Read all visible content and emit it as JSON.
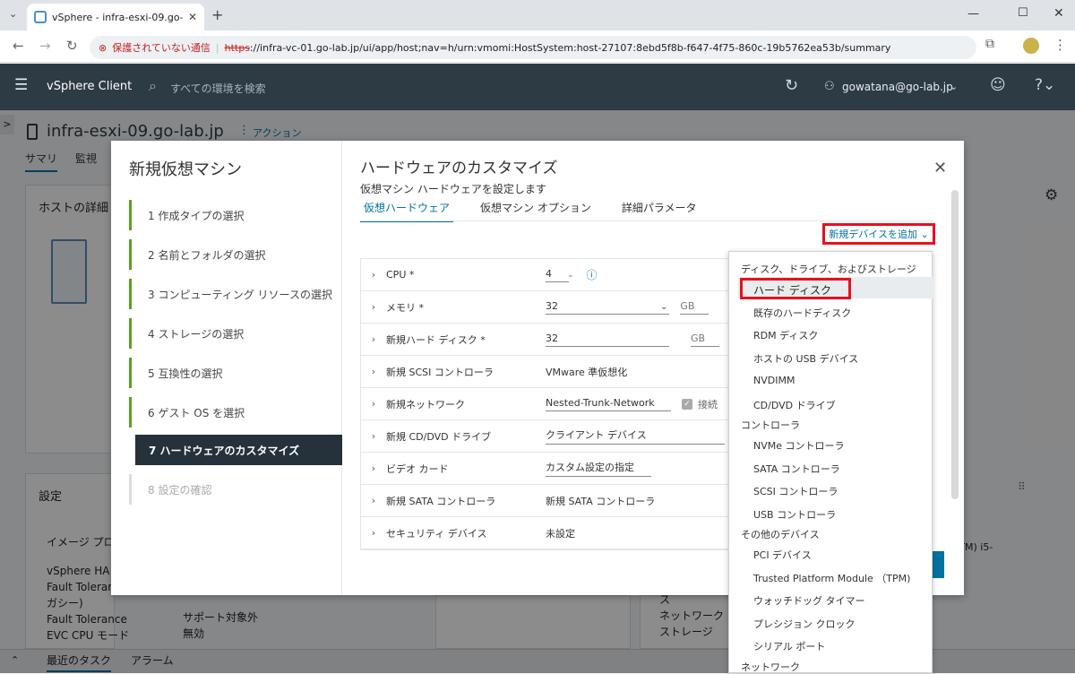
{
  "browser": {
    "tab_title": "vSphere - infra-esxi-09.go-lab.jp",
    "security_label": "保護されていない通信",
    "url_scheme": "https",
    "url_rest": "://infra-vc-01.go-lab.jp/ui/app/host;nav=h/urn:vmomi:HostSystem:host-27107:8ebd5f8b-f647-4f75-860c-19b5762ea53b/summary"
  },
  "header": {
    "app_name": "vSphere Client",
    "search_placeholder": "すべての環境を検索",
    "user": "gowatana@go-lab.jp"
  },
  "host": {
    "name": "infra-esxi-09.go-lab.jp",
    "actions": "アクション",
    "tabs": [
      "サマリ",
      "監視"
    ],
    "card_host_title": "ホストの詳細",
    "card_settings_title": "設定",
    "settings_rows": [
      {
        "label": "イメージ プロ",
        "value": ""
      },
      {
        "label": "vSphere HA",
        "value": ""
      },
      {
        "label": "Fault Toleranc",
        "value": ""
      },
      {
        "label": "ガシー)",
        "value": ""
      },
      {
        "label": "Fault Tolerance",
        "value": "サポート対象外"
      },
      {
        "label": "EVC CPU モード",
        "value": "無効"
      }
    ],
    "right_peek": [
      "ネットワーク",
      "ストレージ"
    ],
    "right_peek_partial": "(TM) i5-"
  },
  "bottombar": {
    "tasks": "最近のタスク",
    "alarms": "アラーム"
  },
  "wizard": {
    "title": "新規仮想マシン",
    "steps": [
      "1  作成タイプの選択",
      "2  名前とフォルダの選択",
      "3  コンピューティング リソースの選択",
      "4  ストレージの選択",
      "5  互換性の選択",
      "6  ゲスト OS を選択",
      "7  ハードウェアのカスタマイズ",
      "8  設定の確認"
    ],
    "active_step": 6,
    "page_title": "ハードウェアのカスタマイズ",
    "page_subtitle": "仮想マシン ハードウェアを設定します",
    "tabs": [
      "仮想ハードウェア",
      "仮想マシン オプション",
      "詳細パラメータ"
    ],
    "add_device": "新規デバイスを追加 ⌄",
    "hardware": [
      {
        "label": "CPU *",
        "value": "4"
      },
      {
        "label": "メモリ *",
        "value": "32",
        "unit": "GB"
      },
      {
        "label": "新規ハード ディスク *",
        "value": "32",
        "unit": "GB"
      },
      {
        "label": "新規 SCSI コントローラ",
        "value": "VMware 準仮想化"
      },
      {
        "label": "新規ネットワーク",
        "value": "Nested-Trunk-Network",
        "extra": "接続"
      },
      {
        "label": "新規 CD/DVD ドライブ",
        "value": "クライアント デバイス"
      },
      {
        "label": "ビデオ カード",
        "value": "カスタム設定の指定"
      },
      {
        "label": "新規 SATA コントローラ",
        "value": "新規 SATA コントローラ"
      },
      {
        "label": "セキュリティ デバイス",
        "value": "未設定"
      }
    ]
  },
  "dropdown": {
    "sections": [
      {
        "header": "ディスク、ドライブ、およびストレージ",
        "items": [
          "ハード ディスク",
          "既存のハードディスク",
          "RDM ディスク",
          "ホストの USB デバイス",
          "NVDIMM",
          "CD/DVD ドライブ"
        ]
      },
      {
        "header": "コントローラ",
        "items": [
          "NVMe コントローラ",
          "SATA コントローラ",
          "SCSI コントローラ",
          "USB コントローラ"
        ]
      },
      {
        "header": "その他のデバイス",
        "items": [
          "PCI デバイス",
          "Trusted Platform Module （TPM)",
          "ウォッチドッグ タイマー",
          "プレシジョン クロック",
          "シリアル ポート"
        ]
      },
      {
        "header": "ネットワーク",
        "items": []
      }
    ]
  },
  "colors": {
    "accent": "#0072a3",
    "highlight": "#e8101f",
    "header_bg": "#2d3b45",
    "step_done": "#5aa220"
  }
}
